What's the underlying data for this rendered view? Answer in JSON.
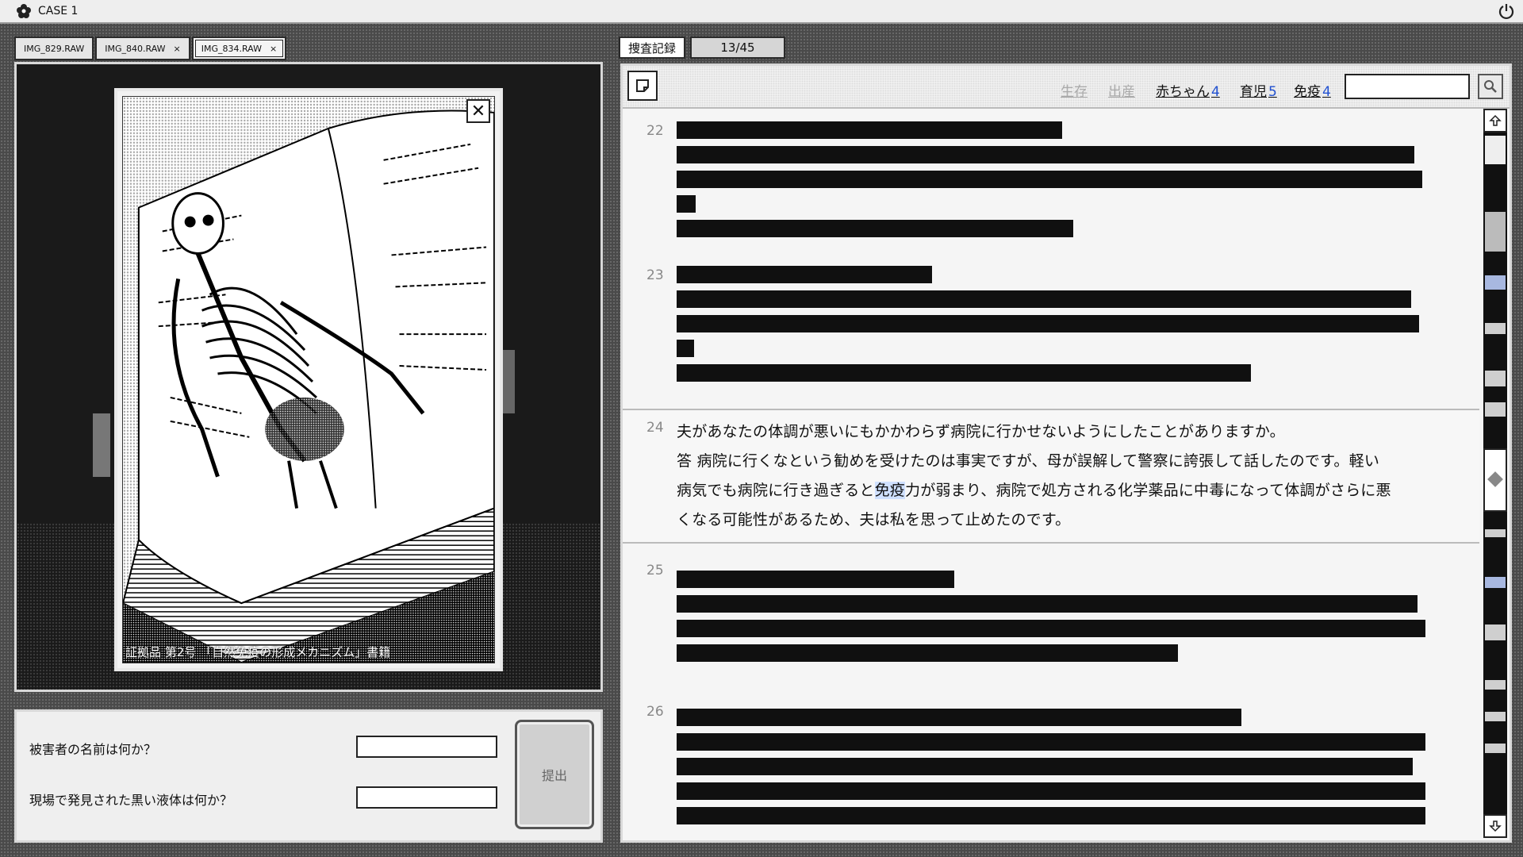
{
  "app": {
    "title": "CASE 1"
  },
  "images": {
    "tabs": [
      {
        "label": "IMG_829.RAW",
        "closable": false
      },
      {
        "label": "IMG_840.RAW",
        "closable": true
      },
      {
        "label": "IMG_834.RAW",
        "closable": true,
        "active": true
      }
    ],
    "close_glyph": "×",
    "viewer": {
      "caption": "証拠品 第2号 「自然免疫の形成メカニズム」書籍",
      "close_glyph": "✕"
    }
  },
  "form": {
    "questions": [
      {
        "label": "被害者の名前は何か？",
        "value": ""
      },
      {
        "label": "現場で発見された黒い液体は何か？",
        "value": ""
      }
    ],
    "submit_label": "提出"
  },
  "record": {
    "tab_label": "捜査記録",
    "page_counter": "13/45",
    "keywords": [
      {
        "label": "生存",
        "count": "",
        "dim": true
      },
      {
        "label": "出産",
        "count": "",
        "dim": true
      },
      {
        "label": "赤ちゃん",
        "count": "4",
        "dim": false
      },
      {
        "label": "育児",
        "count": "5",
        "dim": false
      },
      {
        "label": "免疫",
        "count": "4",
        "dim": false
      }
    ],
    "search": {
      "value": ""
    },
    "entries": [
      {
        "num": "22",
        "redacted": true
      },
      {
        "num": "23",
        "redacted": true
      },
      {
        "num": "24",
        "redacted": false,
        "lines": [
          "夫があなたの体調が悪いにもかかわらず病院に行かせないようにしたことがありますか。",
          "答 病院に行くなという勧めを受けたのは事実ですが、母が誤解して警察に誇張して話したのです。軽い",
          "病気でも病院に行き過ぎると",
          "免疫",
          "力が弱まり、病院で処方される化学薬品に中毒になって体調がさらに悪",
          "くなる可能性があるため、夫は私を思って止めたのです。"
        ]
      },
      {
        "num": "25",
        "redacted": true
      },
      {
        "num": "26",
        "redacted": true
      }
    ]
  }
}
